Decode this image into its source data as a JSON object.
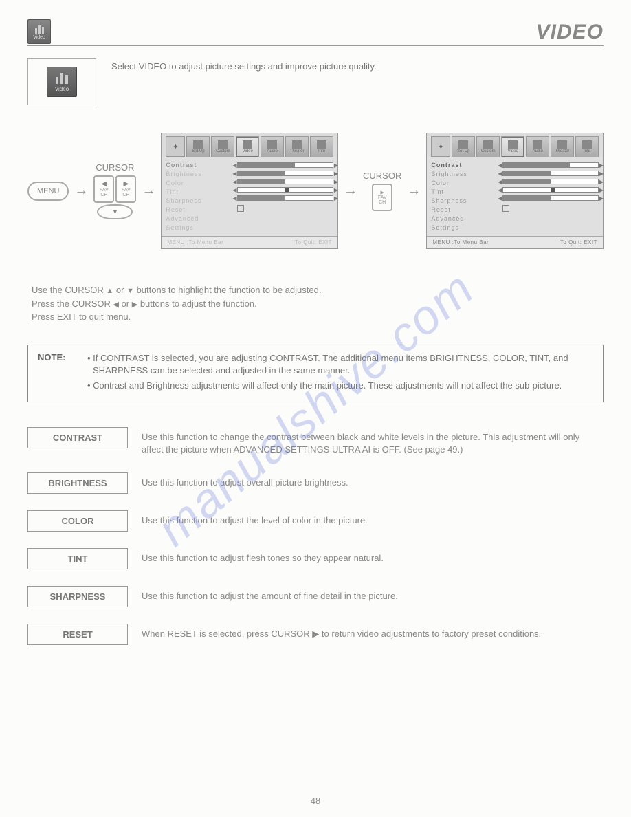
{
  "header": {
    "icon_label": "Video",
    "title": "VIDEO"
  },
  "intro": {
    "icon_label": "Video",
    "text": "Select VIDEO to adjust picture settings and improve picture quality."
  },
  "diagram": {
    "menu_button": "MENU",
    "cursor_label": "CURSOR",
    "fav": "FAV",
    "ch": "CH",
    "osd_tabs": [
      "Set Up",
      "Custom",
      "Video",
      "Audio",
      "Theater",
      "Info"
    ],
    "osd_items": [
      "Contrast",
      "Brightness",
      "Color",
      "Tint",
      "Sharpness",
      "Reset",
      "Advanced",
      "Settings"
    ],
    "osd_footer_left": "MENU :To Menu Bar",
    "osd_footer_right": "To Quit: EXIT"
  },
  "instructions": {
    "line1a": "Use the CURSOR ",
    "line1b": " or ",
    "line1c": " buttons to highlight the function to be adjusted.",
    "line2a": "Press the CURSOR ",
    "line2b": " or ",
    "line2c": " buttons to adjust the function.",
    "line3": "Press EXIT to quit menu."
  },
  "note": {
    "label": "NOTE:",
    "item1": "If CONTRAST is selected, you are adjusting CONTRAST. The additional menu items BRIGHTNESS, COLOR, TINT, and SHARPNESS can be selected and adjusted in the same manner.",
    "item2": "Contrast and Brightness adjustments will affect only the main picture. These adjustments will not affect the sub-picture."
  },
  "functions": [
    {
      "label": "CONTRAST",
      "desc": "Use this function to change the contrast between black and white levels in the picture.  This adjustment will only affect the picture when ADVANCED SETTINGS ULTRA AI is OFF. (See page 49.)"
    },
    {
      "label": "BRIGHTNESS",
      "desc": "Use this function to adjust overall picture brightness."
    },
    {
      "label": "COLOR",
      "desc": "Use this function to adjust the level of color in the picture."
    },
    {
      "label": "TINT",
      "desc": "Use this function to adjust flesh tones so they appear natural."
    },
    {
      "label": "SHARPNESS",
      "desc": "Use this function to adjust the amount of fine detail in the picture."
    },
    {
      "label": "RESET",
      "desc": "When RESET is selected, press CURSOR ▶ to return video adjustments to factory preset conditions."
    }
  ],
  "page_number": "48",
  "watermark": "manualshive.com"
}
